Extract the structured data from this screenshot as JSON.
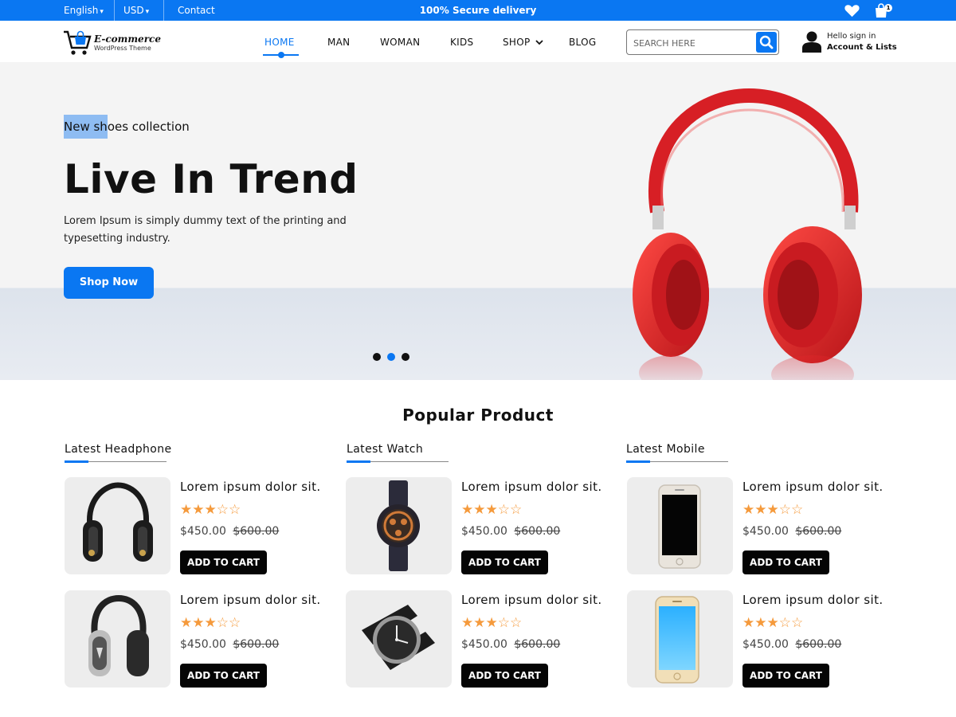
{
  "topbar": {
    "language": "English",
    "currency": "USD",
    "contact": "Contact",
    "notice": "100% Secure delivery",
    "cart_count": "1",
    "icons": [
      "heart-icon",
      "shopping-bag-icon",
      "chevron-down-icon"
    ]
  },
  "header": {
    "logo_title": "E-commerce",
    "logo_subtitle": "WordPress Theme",
    "nav": [
      {
        "label": "HOME",
        "active": true
      },
      {
        "label": "MAN"
      },
      {
        "label": "WOMAN"
      },
      {
        "label": "KIDS"
      },
      {
        "label": "SHOP"
      },
      {
        "label": "BLOG"
      }
    ],
    "search_placeholder": "SEARCH HERE",
    "account_line1": "Hello sign in",
    "account_line2": "Account & Lists"
  },
  "hero": {
    "kicker_highlight": "New sh",
    "kicker_rest": "oes collection",
    "title": "Live In Trend",
    "description": "Lorem Ipsum is simply dummy text of the printing and typesetting industry.",
    "button": "Shop Now",
    "slides": 3,
    "active_slide": 2
  },
  "products": {
    "section_title": "Popular Product",
    "columns": [
      {
        "heading": "Latest Headphone",
        "items": [
          {
            "name": "Lorem ipsum dolor sit.",
            "rating": 3,
            "rating_max": 5,
            "stars": "★★★☆☆",
            "price": "$450.00",
            "old_price": "$600.00",
            "button": "ADD TO CART",
            "image": "headphone-black"
          },
          {
            "name": "Lorem ipsum dolor sit.",
            "rating": 3,
            "rating_max": 5,
            "stars": "★★★☆☆",
            "price": "$450.00",
            "old_price": "$600.00",
            "button": "ADD TO CART",
            "image": "headphone-silver"
          }
        ]
      },
      {
        "heading": "Latest Watch",
        "items": [
          {
            "name": "Lorem ipsum dolor sit.",
            "rating": 3,
            "rating_max": 5,
            "stars": "★★★☆☆",
            "price": "$450.00",
            "old_price": "$600.00",
            "button": "ADD TO CART",
            "image": "watch-sport"
          },
          {
            "name": "Lorem ipsum dolor sit.",
            "rating": 3,
            "rating_max": 5,
            "stars": "★★★☆☆",
            "price": "$450.00",
            "old_price": "$600.00",
            "button": "ADD TO CART",
            "image": "watch-classic"
          }
        ]
      },
      {
        "heading": "Latest Mobile",
        "items": [
          {
            "name": "Lorem ipsum dolor sit.",
            "rating": 3,
            "rating_max": 5,
            "stars": "★★★☆☆",
            "price": "$450.00",
            "old_price": "$600.00",
            "button": "ADD TO CART",
            "image": "phone-black"
          },
          {
            "name": "Lorem ipsum dolor sit.",
            "rating": 3,
            "rating_max": 5,
            "stars": "★★★☆☆",
            "price": "$450.00",
            "old_price": "$600.00",
            "button": "ADD TO CART",
            "image": "phone-blue"
          }
        ]
      }
    ]
  },
  "colors": {
    "accent": "#0a77f2",
    "star": "#f59a3c",
    "button_dark": "#050505",
    "hero_bg": "#f4f4f4",
    "headphone_red": "#e3262b"
  }
}
